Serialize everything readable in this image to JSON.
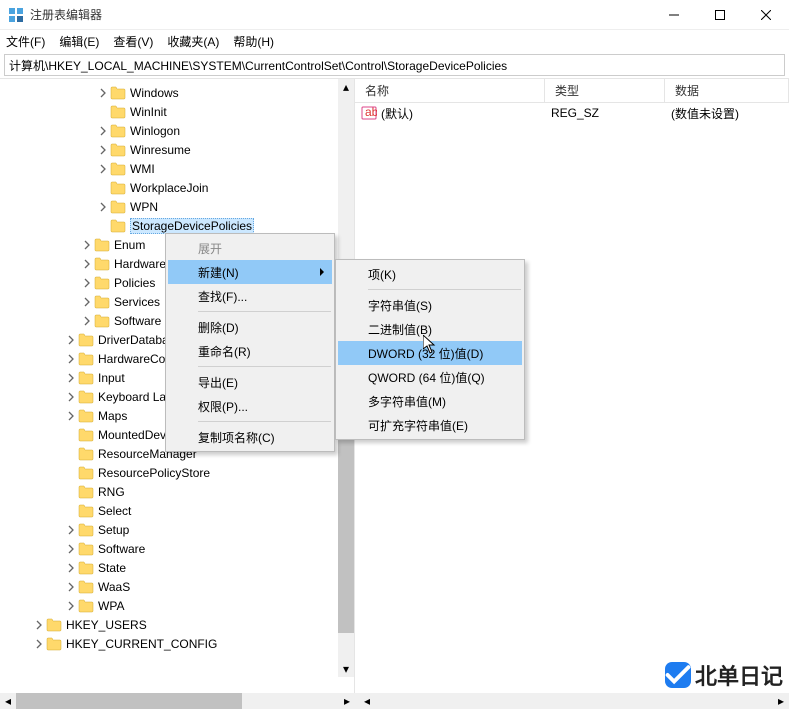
{
  "window": {
    "title": "注册表编辑器"
  },
  "menubar": [
    "文件(F)",
    "编辑(E)",
    "查看(V)",
    "收藏夹(A)",
    "帮助(H)"
  ],
  "address": "计算机\\HKEY_LOCAL_MACHINE\\SYSTEM\\CurrentControlSet\\Control\\StorageDevicePolicies",
  "tree": [
    {
      "label": "Windows",
      "indent": 96,
      "expander": "closed"
    },
    {
      "label": "WinInit",
      "indent": 96,
      "expander": "none"
    },
    {
      "label": "Winlogon",
      "indent": 96,
      "expander": "closed"
    },
    {
      "label": "Winresume",
      "indent": 96,
      "expander": "closed"
    },
    {
      "label": "WMI",
      "indent": 96,
      "expander": "closed"
    },
    {
      "label": "WorkplaceJoin",
      "indent": 96,
      "expander": "none"
    },
    {
      "label": "WPN",
      "indent": 96,
      "expander": "closed"
    },
    {
      "label": "StorageDevicePolicies",
      "indent": 96,
      "expander": "none",
      "selected": true
    },
    {
      "label": "Enum",
      "indent": 80,
      "expander": "closed"
    },
    {
      "label": "Hardware",
      "indent": 80,
      "expander": "closed",
      "trunc": true
    },
    {
      "label": "Policies",
      "indent": 80,
      "expander": "closed"
    },
    {
      "label": "Services",
      "indent": 80,
      "expander": "closed"
    },
    {
      "label": "Software",
      "indent": 80,
      "expander": "closed"
    },
    {
      "label": "DriverDataba",
      "indent": 64,
      "expander": "closed",
      "trunc": true
    },
    {
      "label": "HardwareCo",
      "indent": 64,
      "expander": "closed",
      "trunc": true
    },
    {
      "label": "Input",
      "indent": 64,
      "expander": "closed"
    },
    {
      "label": "Keyboard La",
      "indent": 64,
      "expander": "closed",
      "trunc": true
    },
    {
      "label": "Maps",
      "indent": 64,
      "expander": "closed"
    },
    {
      "label": "MountedDevices",
      "indent": 64,
      "expander": "none"
    },
    {
      "label": "ResourceManager",
      "indent": 64,
      "expander": "none"
    },
    {
      "label": "ResourcePolicyStore",
      "indent": 64,
      "expander": "none"
    },
    {
      "label": "RNG",
      "indent": 64,
      "expander": "none"
    },
    {
      "label": "Select",
      "indent": 64,
      "expander": "none"
    },
    {
      "label": "Setup",
      "indent": 64,
      "expander": "closed"
    },
    {
      "label": "Software",
      "indent": 64,
      "expander": "closed"
    },
    {
      "label": "State",
      "indent": 64,
      "expander": "closed"
    },
    {
      "label": "WaaS",
      "indent": 64,
      "expander": "closed"
    },
    {
      "label": "WPA",
      "indent": 64,
      "expander": "closed"
    },
    {
      "label": "HKEY_USERS",
      "indent": 32,
      "expander": "closed"
    },
    {
      "label": "HKEY_CURRENT_CONFIG",
      "indent": 32,
      "expander": "closed"
    }
  ],
  "list": {
    "headers": {
      "name": "名称",
      "type": "类型",
      "data": "数据"
    },
    "rows": [
      {
        "name": "(默认)",
        "type": "REG_SZ",
        "data": "(数值未设置)"
      }
    ]
  },
  "context_menu1": {
    "items": [
      {
        "label": "展开",
        "disabled": true
      },
      {
        "label": "新建(N)",
        "submenu": true,
        "highlight": true
      },
      {
        "label": "查找(F)..."
      },
      {
        "sep": true
      },
      {
        "label": "删除(D)"
      },
      {
        "label": "重命名(R)"
      },
      {
        "sep": true
      },
      {
        "label": "导出(E)"
      },
      {
        "label": "权限(P)..."
      },
      {
        "sep": true
      },
      {
        "label": "复制项名称(C)"
      }
    ]
  },
  "context_menu2": {
    "items": [
      {
        "label": "项(K)"
      },
      {
        "sep": true
      },
      {
        "label": "字符串值(S)"
      },
      {
        "label": "二进制值(B)"
      },
      {
        "label": "DWORD (32 位)值(D)",
        "highlight": true
      },
      {
        "label": "QWORD (64 位)值(Q)"
      },
      {
        "label": "多字符串值(M)"
      },
      {
        "label": "可扩充字符串值(E)"
      }
    ]
  },
  "watermark": "北单日记"
}
